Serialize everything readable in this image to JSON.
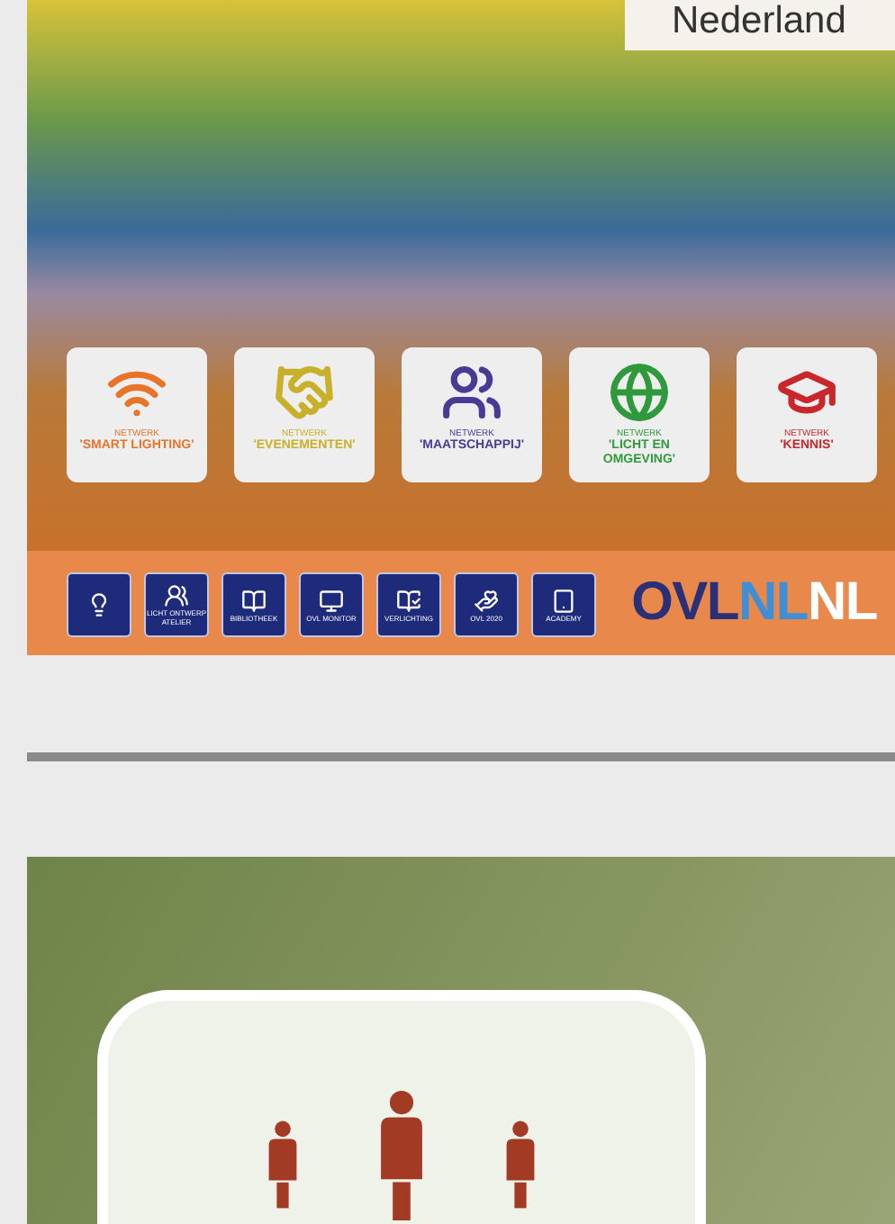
{
  "poster": {
    "heading": "Nederland",
    "networks": [
      {
        "prefix": "NETWERK",
        "name": "'SMART LIGHTING'",
        "color": "#e8742a"
      },
      {
        "prefix": "NETWERK",
        "name": "'EVENEMENTEN'",
        "color": "#c9b02a"
      },
      {
        "prefix": "NETWERK",
        "name": "'MAATSCHAPPIJ'",
        "color": "#4b3a94"
      },
      {
        "prefix": "NETWERK",
        "name": "'LICHT EN OMGEVING'",
        "color": "#2f9a3c"
      },
      {
        "prefix": "NETWERK",
        "name": "'KENNIS'",
        "color": "#c8282c"
      }
    ],
    "tools": [
      {
        "label": "LICHT ONTWERP ATELIER"
      },
      {
        "label": "BIBLIOTHEEK"
      },
      {
        "label": "OVL MONITOR"
      },
      {
        "label": "VERLICHTING"
      },
      {
        "label": "OVL 2020"
      },
      {
        "label": "ACADEMY"
      }
    ],
    "logo": [
      {
        "text": "OVL",
        "color": "#2a2f7a"
      },
      {
        "text": "NL",
        "color": "#3f8fd8"
      },
      {
        "text": "NL",
        "color": "#ffffff"
      }
    ]
  }
}
